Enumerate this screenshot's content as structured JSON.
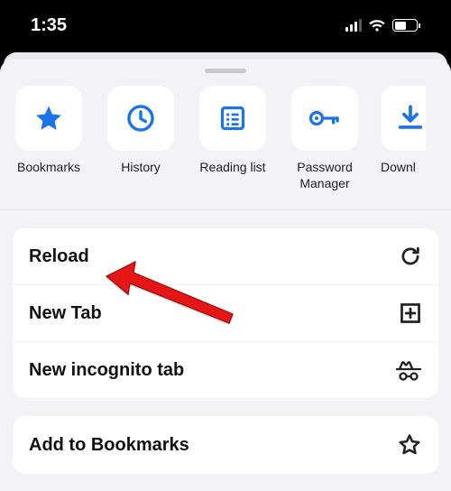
{
  "status": {
    "time": "1:35",
    "battery_percent": 55
  },
  "shortcuts": [
    {
      "label": "Bookmarks",
      "icon": "star-filled"
    },
    {
      "label": "History",
      "icon": "clock"
    },
    {
      "label": "Reading list",
      "icon": "reading-list"
    },
    {
      "label": "Password\nManager",
      "icon": "key"
    },
    {
      "label": "Downl",
      "icon": "download"
    }
  ],
  "menu": {
    "group1": [
      {
        "label": "Reload",
        "icon": "reload"
      },
      {
        "label": "New Tab",
        "icon": "plus-square"
      },
      {
        "label": "New incognito tab",
        "icon": "incognito"
      }
    ],
    "group2": [
      {
        "label": "Add to Bookmarks",
        "icon": "star-outline"
      }
    ]
  },
  "annotation": {
    "target": "reload",
    "type": "arrow-red"
  },
  "colors": {
    "accent": "#1a73e8"
  }
}
